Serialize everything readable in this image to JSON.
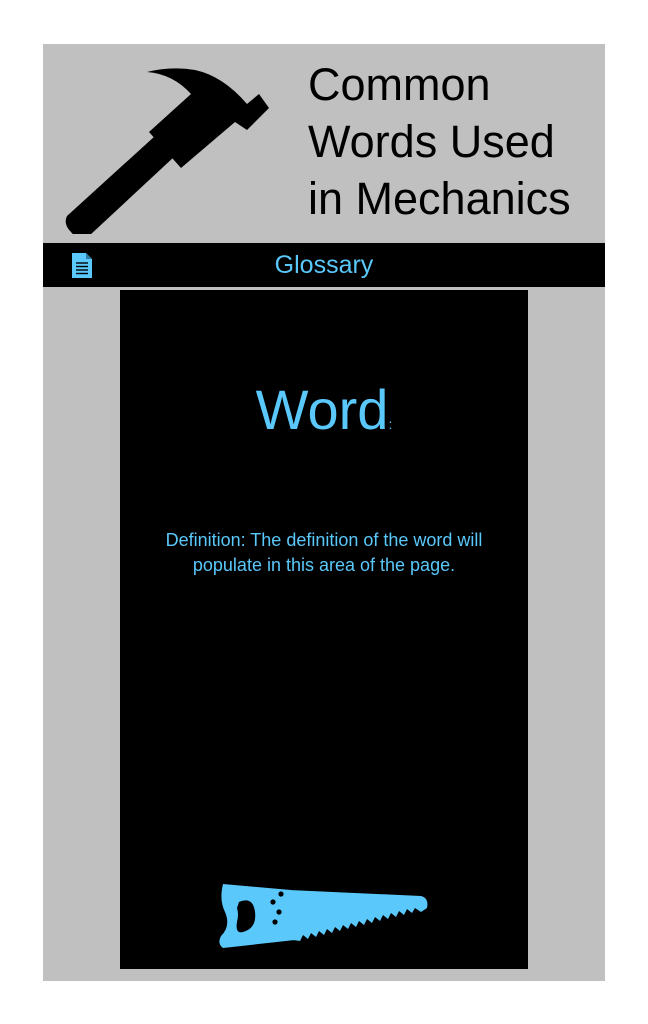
{
  "header": {
    "title_line1": "Common",
    "title_line2": "Words Used",
    "title_line3": "in Mechanics",
    "logo_icon": "hammer-icon"
  },
  "nav": {
    "icon": "document-icon",
    "title": "Glossary"
  },
  "card": {
    "word": "Word",
    "word_suffix": ":",
    "definition": "Definition: The definition of the word will populate in this area of the page.",
    "footer_icon": "saw-icon"
  },
  "colors": {
    "accent": "#5ac8fa",
    "background": "#c0c0c0",
    "panel": "#000000"
  }
}
